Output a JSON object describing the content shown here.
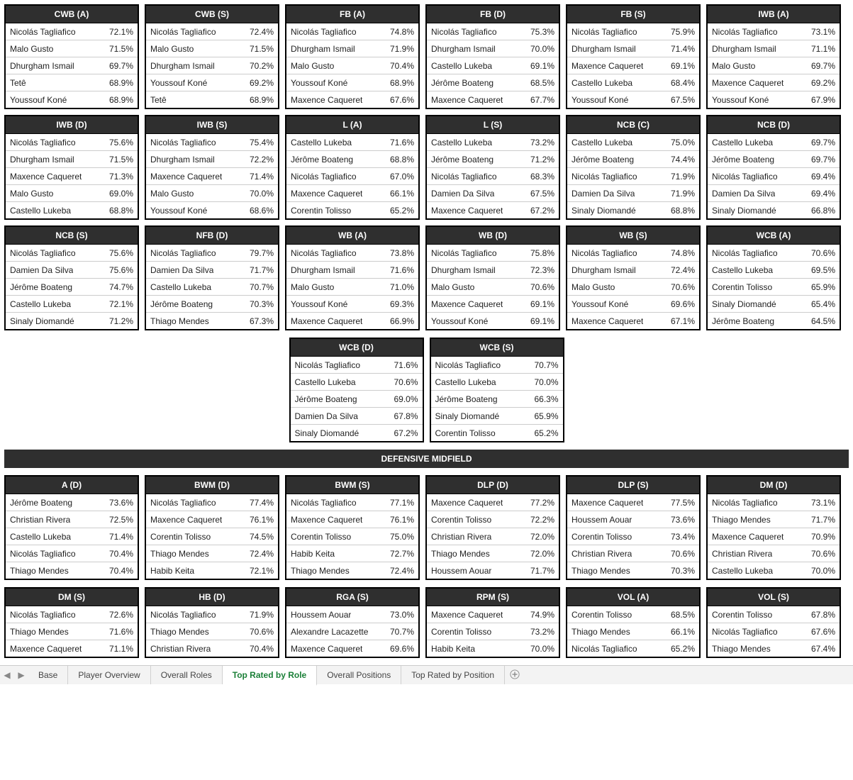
{
  "sections": {
    "defensive_midfield_label": "DEFENSIVE MIDFIELD"
  },
  "tabs": {
    "items": [
      "Base",
      "Player Overview",
      "Overall Roles",
      "Top Rated by Role",
      "Overall Positions",
      "Top Rated by Position"
    ],
    "active_index": 3
  },
  "group1_titles": [
    "CWB (A)",
    "CWB (S)",
    "FB (A)",
    "FB (D)",
    "FB (S)",
    "IWB (A)",
    "IWB (D)",
    "IWB (S)",
    "L (A)",
    "L (S)",
    "NCB (C)",
    "NCB (D)",
    "NCB (S)",
    "NFB (D)",
    "WB (A)",
    "WB (D)",
    "WB (S)",
    "WCB (A)"
  ],
  "group1_values": [
    [
      [
        "Nicolás Tagliafico",
        "72.1%"
      ],
      [
        "Malo Gusto",
        "71.5%"
      ],
      [
        "Dhurgham Ismail",
        "69.7%"
      ],
      [
        "Tetê",
        "68.9%"
      ],
      [
        "Youssouf Koné",
        "68.9%"
      ]
    ],
    [
      [
        "Nicolás Tagliafico",
        "72.4%"
      ],
      [
        "Malo Gusto",
        "71.5%"
      ],
      [
        "Dhurgham Ismail",
        "70.2%"
      ],
      [
        "Youssouf Koné",
        "69.2%"
      ],
      [
        "Tetê",
        "68.9%"
      ]
    ],
    [
      [
        "Nicolás Tagliafico",
        "74.8%"
      ],
      [
        "Dhurgham Ismail",
        "71.9%"
      ],
      [
        "Malo Gusto",
        "70.4%"
      ],
      [
        "Youssouf Koné",
        "68.9%"
      ],
      [
        "Maxence Caqueret",
        "67.6%"
      ]
    ],
    [
      [
        "Nicolás Tagliafico",
        "75.3%"
      ],
      [
        "Dhurgham Ismail",
        "70.0%"
      ],
      [
        "Castello Lukeba",
        "69.1%"
      ],
      [
        "Jérôme Boateng",
        "68.5%"
      ],
      [
        "Maxence Caqueret",
        "67.7%"
      ]
    ],
    [
      [
        "Nicolás Tagliafico",
        "75.9%"
      ],
      [
        "Dhurgham Ismail",
        "71.4%"
      ],
      [
        "Maxence Caqueret",
        "69.1%"
      ],
      [
        "Castello Lukeba",
        "68.4%"
      ],
      [
        "Youssouf Koné",
        "67.5%"
      ]
    ],
    [
      [
        "Nicolás Tagliafico",
        "73.1%"
      ],
      [
        "Dhurgham Ismail",
        "71.1%"
      ],
      [
        "Malo Gusto",
        "69.7%"
      ],
      [
        "Maxence Caqueret",
        "69.2%"
      ],
      [
        "Youssouf Koné",
        "67.9%"
      ]
    ],
    [
      [
        "Nicolás Tagliafico",
        "75.6%"
      ],
      [
        "Dhurgham Ismail",
        "71.5%"
      ],
      [
        "Maxence Caqueret",
        "71.3%"
      ],
      [
        "Malo Gusto",
        "69.0%"
      ],
      [
        "Castello Lukeba",
        "68.8%"
      ]
    ],
    [
      [
        "Nicolás Tagliafico",
        "75.4%"
      ],
      [
        "Dhurgham Ismail",
        "72.2%"
      ],
      [
        "Maxence Caqueret",
        "71.4%"
      ],
      [
        "Malo Gusto",
        "70.0%"
      ],
      [
        "Youssouf Koné",
        "68.6%"
      ]
    ],
    [
      [
        "Castello Lukeba",
        "71.6%"
      ],
      [
        "Jérôme Boateng",
        "68.8%"
      ],
      [
        "Nicolás Tagliafico",
        "67.0%"
      ],
      [
        "Maxence Caqueret",
        "66.1%"
      ],
      [
        "Corentin Tolisso",
        "65.2%"
      ]
    ],
    [
      [
        "Castello Lukeba",
        "73.2%"
      ],
      [
        "Jérôme Boateng",
        "71.2%"
      ],
      [
        "Nicolás Tagliafico",
        "68.3%"
      ],
      [
        "Damien Da Silva",
        "67.5%"
      ],
      [
        "Maxence Caqueret",
        "67.2%"
      ]
    ],
    [
      [
        "Castello Lukeba",
        "75.0%"
      ],
      [
        "Jérôme Boateng",
        "74.4%"
      ],
      [
        "Nicolás Tagliafico",
        "71.9%"
      ],
      [
        "Damien Da Silva",
        "71.9%"
      ],
      [
        "Sinaly Diomandé",
        "68.8%"
      ]
    ],
    [
      [
        "Castello Lukeba",
        "69.7%"
      ],
      [
        "Jérôme Boateng",
        "69.7%"
      ],
      [
        "Nicolás Tagliafico",
        "69.4%"
      ],
      [
        "Damien Da Silva",
        "69.4%"
      ],
      [
        "Sinaly Diomandé",
        "66.8%"
      ]
    ],
    [
      [
        "Nicolás Tagliafico",
        "75.6%"
      ],
      [
        "Damien Da Silva",
        "75.6%"
      ],
      [
        "Jérôme Boateng",
        "74.7%"
      ],
      [
        "Castello Lukeba",
        "72.1%"
      ],
      [
        "Sinaly Diomandé",
        "71.2%"
      ]
    ],
    [
      [
        "Nicolás Tagliafico",
        "79.7%"
      ],
      [
        "Damien Da Silva",
        "71.7%"
      ],
      [
        "Castello Lukeba",
        "70.7%"
      ],
      [
        "Jérôme Boateng",
        "70.3%"
      ],
      [
        "Thiago Mendes",
        "67.3%"
      ]
    ],
    [
      [
        "Nicolás Tagliafico",
        "73.8%"
      ],
      [
        "Dhurgham Ismail",
        "71.6%"
      ],
      [
        "Malo Gusto",
        "71.0%"
      ],
      [
        "Youssouf Koné",
        "69.3%"
      ],
      [
        "Maxence Caqueret",
        "66.9%"
      ]
    ],
    [
      [
        "Nicolás Tagliafico",
        "75.8%"
      ],
      [
        "Dhurgham Ismail",
        "72.3%"
      ],
      [
        "Malo Gusto",
        "70.6%"
      ],
      [
        "Maxence Caqueret",
        "69.1%"
      ],
      [
        "Youssouf Koné",
        "69.1%"
      ]
    ],
    [
      [
        "Nicolás Tagliafico",
        "74.8%"
      ],
      [
        "Dhurgham Ismail",
        "72.4%"
      ],
      [
        "Malo Gusto",
        "70.6%"
      ],
      [
        "Youssouf Koné",
        "69.6%"
      ],
      [
        "Maxence Caqueret",
        "67.1%"
      ]
    ],
    [
      [
        "Nicolás Tagliafico",
        "70.6%"
      ],
      [
        "Castello Lukeba",
        "69.5%"
      ],
      [
        "Corentin Tolisso",
        "65.9%"
      ],
      [
        "Sinaly Diomandé",
        "65.4%"
      ],
      [
        "Jérôme Boateng",
        "64.5%"
      ]
    ]
  ],
  "group2_titles": [
    "WCB (D)",
    "WCB (S)"
  ],
  "group2_values": [
    [
      [
        "Nicolás Tagliafico",
        "71.6%"
      ],
      [
        "Castello Lukeba",
        "70.6%"
      ],
      [
        "Jérôme Boateng",
        "69.0%"
      ],
      [
        "Damien Da Silva",
        "67.8%"
      ],
      [
        "Sinaly Diomandé",
        "67.2%"
      ]
    ],
    [
      [
        "Nicolás Tagliafico",
        "70.7%"
      ],
      [
        "Castello Lukeba",
        "70.0%"
      ],
      [
        "Jérôme Boateng",
        "66.3%"
      ],
      [
        "Sinaly Diomandé",
        "65.9%"
      ],
      [
        "Corentin Tolisso",
        "65.2%"
      ]
    ]
  ],
  "group3_titles": [
    "A (D)",
    "BWM (D)",
    "BWM (S)",
    "DLP (D)",
    "DLP (S)",
    "DM (D)"
  ],
  "group3_values": [
    [
      [
        "Jérôme Boateng",
        "73.6%"
      ],
      [
        "Christian Rivera",
        "72.5%"
      ],
      [
        "Castello Lukeba",
        "71.4%"
      ],
      [
        "Nicolás Tagliafico",
        "70.4%"
      ],
      [
        "Thiago Mendes",
        "70.4%"
      ]
    ],
    [
      [
        "Nicolás Tagliafico",
        "77.4%"
      ],
      [
        "Maxence Caqueret",
        "76.1%"
      ],
      [
        "Corentin Tolisso",
        "74.5%"
      ],
      [
        "Thiago Mendes",
        "72.4%"
      ],
      [
        "Habib Keita",
        "72.1%"
      ]
    ],
    [
      [
        "Nicolás Tagliafico",
        "77.1%"
      ],
      [
        "Maxence Caqueret",
        "76.1%"
      ],
      [
        "Corentin Tolisso",
        "75.0%"
      ],
      [
        "Habib Keita",
        "72.7%"
      ],
      [
        "Thiago Mendes",
        "72.4%"
      ]
    ],
    [
      [
        "Maxence Caqueret",
        "77.2%"
      ],
      [
        "Corentin Tolisso",
        "72.2%"
      ],
      [
        "Christian Rivera",
        "72.0%"
      ],
      [
        "Thiago Mendes",
        "72.0%"
      ],
      [
        "Houssem Aouar",
        "71.7%"
      ]
    ],
    [
      [
        "Maxence Caqueret",
        "77.5%"
      ],
      [
        "Houssem Aouar",
        "73.6%"
      ],
      [
        "Corentin Tolisso",
        "73.4%"
      ],
      [
        "Christian Rivera",
        "70.6%"
      ],
      [
        "Thiago Mendes",
        "70.3%"
      ]
    ],
    [
      [
        "Nicolás Tagliafico",
        "73.1%"
      ],
      [
        "Thiago Mendes",
        "71.7%"
      ],
      [
        "Maxence Caqueret",
        "70.9%"
      ],
      [
        "Christian Rivera",
        "70.6%"
      ],
      [
        "Castello Lukeba",
        "70.0%"
      ]
    ]
  ],
  "group4_titles": [
    "DM (S)",
    "HB (D)",
    "RGA (S)",
    "RPM (S)",
    "VOL (A)",
    "VOL (S)"
  ],
  "group4_values": [
    [
      [
        "Nicolás Tagliafico",
        "72.6%"
      ],
      [
        "Thiago Mendes",
        "71.6%"
      ],
      [
        "Maxence Caqueret",
        "71.1%"
      ]
    ],
    [
      [
        "Nicolás Tagliafico",
        "71.9%"
      ],
      [
        "Thiago Mendes",
        "70.6%"
      ],
      [
        "Christian Rivera",
        "70.4%"
      ]
    ],
    [
      [
        "Houssem Aouar",
        "73.0%"
      ],
      [
        "Alexandre Lacazette",
        "70.7%"
      ],
      [
        "Maxence Caqueret",
        "69.6%"
      ]
    ],
    [
      [
        "Maxence Caqueret",
        "74.9%"
      ],
      [
        "Corentin Tolisso",
        "73.2%"
      ],
      [
        "Habib Keita",
        "70.0%"
      ]
    ],
    [
      [
        "Corentin Tolisso",
        "68.5%"
      ],
      [
        "Thiago Mendes",
        "66.1%"
      ],
      [
        "Nicolás Tagliafico",
        "65.2%"
      ]
    ],
    [
      [
        "Corentin Tolisso",
        "67.8%"
      ],
      [
        "Nicolás Tagliafico",
        "67.6%"
      ],
      [
        "Thiago Mendes",
        "67.4%"
      ]
    ]
  ]
}
